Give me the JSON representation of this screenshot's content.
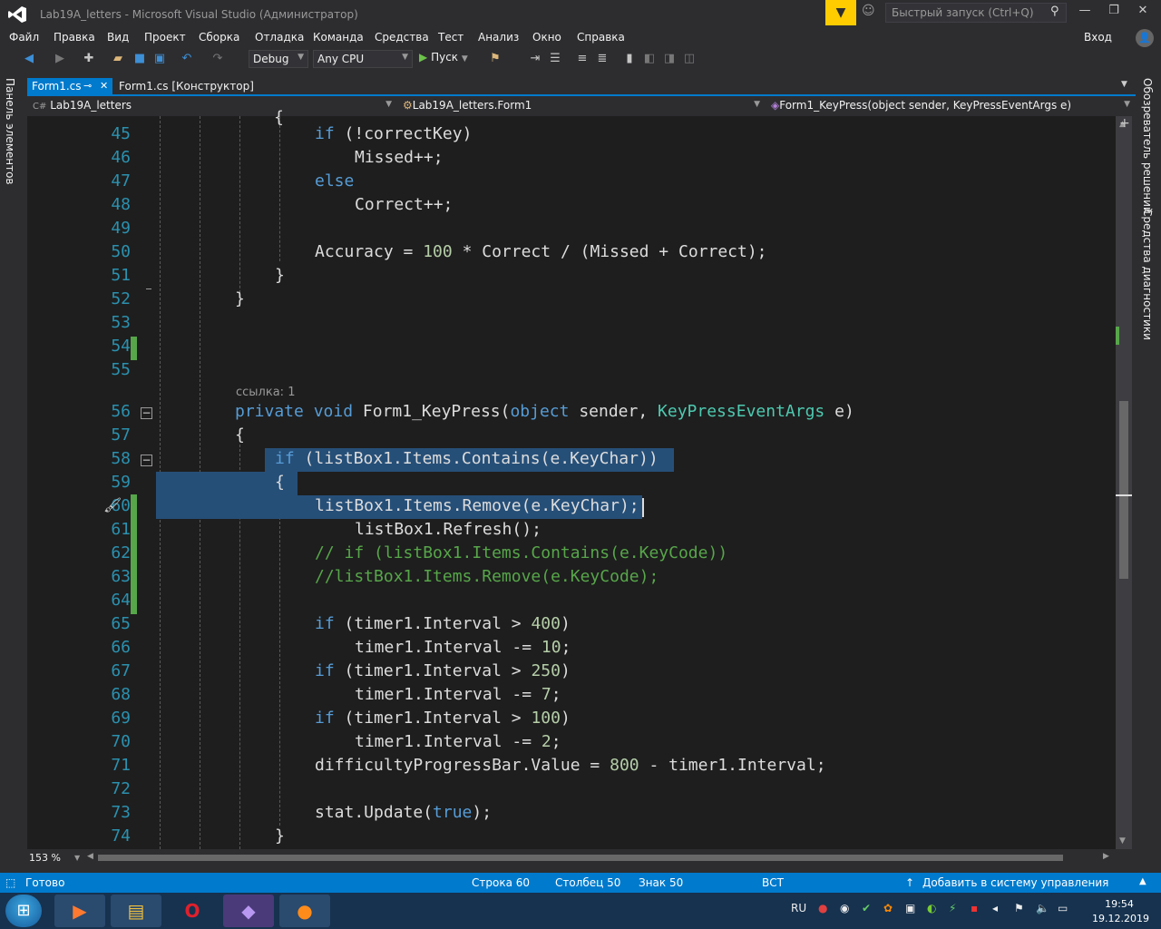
{
  "window": {
    "title": "Lab19A_letters - Microsoft Visual Studio  (Администратор)",
    "quick_launch_placeholder": "Быстрый запуск (Ctrl+Q)",
    "login_label": "Вход"
  },
  "menu": [
    "Файл",
    "Правка",
    "Вид",
    "Проект",
    "Сборка",
    "Отладка",
    "Команда",
    "Средства",
    "Тест",
    "Анализ",
    "Окно",
    "Справка"
  ],
  "toolbar": {
    "config": "Debug",
    "platform": "Any CPU",
    "start_label": "Пуск"
  },
  "side_panels": {
    "left": "Панель элементов",
    "right_top": "Обозреватель решений",
    "right_bottom": "Средства диагностики"
  },
  "tabs": [
    {
      "label": "Form1.cs",
      "active": true
    },
    {
      "label": "Form1.cs [Конструктор]",
      "active": false
    }
  ],
  "navbar": {
    "project": "Lab19A_letters",
    "class": "Lab19A_letters.Form1",
    "member": "Form1_KeyPress(object sender, KeyPressEventArgs e)"
  },
  "editor": {
    "codelens": "ссылка: 1",
    "lines": [
      {
        "n": "45",
        "text": "if (!correctKey)"
      },
      {
        "n": "46",
        "text": "Missed++;"
      },
      {
        "n": "47",
        "text": "else"
      },
      {
        "n": "48",
        "text": "Correct++;"
      },
      {
        "n": "49",
        "text": ""
      },
      {
        "n": "50",
        "text": "Accuracy = 100 * Correct / (Missed + Correct);"
      },
      {
        "n": "51",
        "text": "}"
      },
      {
        "n": "52",
        "text": "}"
      },
      {
        "n": "53",
        "text": ""
      },
      {
        "n": "54",
        "text": ""
      },
      {
        "n": "55",
        "text": ""
      },
      {
        "n": "56",
        "text": "private void Form1_KeyPress(object sender, KeyPressEventArgs e)"
      },
      {
        "n": "57",
        "text": "{"
      },
      {
        "n": "58",
        "text": "if (listBox1.Items.Contains(e.KeyChar))"
      },
      {
        "n": "59",
        "text": "{"
      },
      {
        "n": "60",
        "text": "listBox1.Items.Remove(e.KeyChar);"
      },
      {
        "n": "61",
        "text": "listBox1.Refresh();"
      },
      {
        "n": "62",
        "text": "// if (listBox1.Items.Contains(e.KeyCode))"
      },
      {
        "n": "63",
        "text": "//listBox1.Items.Remove(e.KeyCode);"
      },
      {
        "n": "64",
        "text": ""
      },
      {
        "n": "65",
        "text": "if (timer1.Interval > 400)"
      },
      {
        "n": "66",
        "text": "timer1.Interval -= 10;"
      },
      {
        "n": "67",
        "text": "if (timer1.Interval > 250)"
      },
      {
        "n": "68",
        "text": "timer1.Interval -= 7;"
      },
      {
        "n": "69",
        "text": "if (timer1.Interval > 100)"
      },
      {
        "n": "70",
        "text": "timer1.Interval -= 2;"
      },
      {
        "n": "71",
        "text": "difficultyProgressBar.Value = 800 - timer1.Interval;"
      },
      {
        "n": "72",
        "text": ""
      },
      {
        "n": "73",
        "text": "stat.Update(true);"
      },
      {
        "n": "74",
        "text": "}"
      }
    ]
  },
  "zoom": "153 %",
  "status": {
    "ready": "Готово",
    "line": "Строка 60",
    "column": "Столбец 50",
    "char": "Знак 50",
    "mode": "ВСТ",
    "vcs": "Добавить в систему управления версиями"
  },
  "taskbar": {
    "lang": "RU",
    "time": "19:54",
    "date": "19.12.2019"
  },
  "colors": {
    "accent": "#007acc",
    "keyword": "#569cd6",
    "type": "#4ec9b0",
    "number": "#b5cea8",
    "comment": "#57a64a",
    "line_number": "#2b91af",
    "selection": "#264f78"
  }
}
